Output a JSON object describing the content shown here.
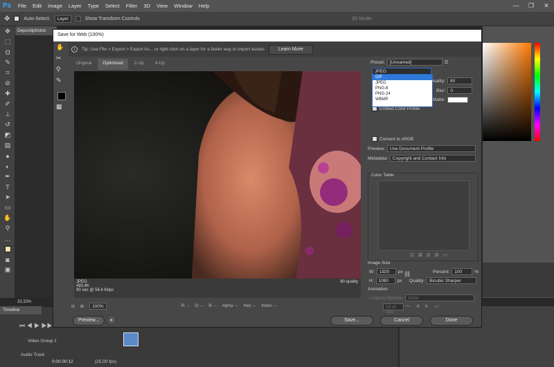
{
  "menubar": {
    "logo": "Ps",
    "items": [
      "File",
      "Edit",
      "Image",
      "Layer",
      "Type",
      "Select",
      "Filter",
      "3D",
      "View",
      "Window",
      "Help"
    ]
  },
  "window_controls": [
    "—",
    "❐",
    "✕"
  ],
  "options_bar": {
    "auto_select_label": "Auto-Select:",
    "auto_select_value": "Layer",
    "transform_label": "Show Transform Controls",
    "mode_label": "3D Mode:"
  },
  "document": {
    "tab_title": "Depositphotos",
    "zoom": "33,33%"
  },
  "timeline": {
    "tab": "Timeline",
    "video_group": "Video Group 1",
    "audio_track": "Audio Track",
    "timecode": "0:00:00:12",
    "fps": "(25,00 fps)"
  },
  "dialog": {
    "title": "Save for Web (100%)",
    "tip": "Tip: Use File > Export > Export As... or right click on a layer for a faster way to export assets",
    "learn_more": "Learn More",
    "tabs": [
      "Original",
      "Optimized",
      "2-Up",
      "4-Up"
    ],
    "active_tab": "Optimized",
    "preview_info": {
      "format": "JPEG",
      "size": "493,4K",
      "time": "90 sec @ 56.6 Kbps",
      "quality": "80 quality"
    },
    "zoom_value": "100%",
    "readouts": [
      "R: --",
      "G: --",
      "B: --",
      "Alpha: --",
      "Hex: --",
      "Index: --"
    ],
    "settings": {
      "preset_label": "Preset:",
      "preset_value": "[Unnamed]",
      "format_value": "JPEG",
      "format_options": [
        "GIF",
        "JPEG",
        "PNG-8",
        "PNG-24",
        "WBMP"
      ],
      "highlighted_option": "GIF",
      "quality_label": "Quality:",
      "quality_value": "80",
      "blur_label": "Blur:",
      "blur_value": "0",
      "matte_label": "Matte:",
      "embed_label": "Embed Color Profile",
      "convert_label": "Convert to sRGB",
      "preview_label": "Preview:",
      "preview_value": "Use Document Profile",
      "metadata_label": "Metadata:",
      "metadata_value": "Copyright and Contact Info",
      "color_table_label": "Color Table",
      "image_size_label": "Image Size",
      "w_label": "W:",
      "w_value": "1920",
      "h_label": "H:",
      "h_value": "1080",
      "unit": "px",
      "percent_label": "Percent:",
      "percent_value": "100",
      "percent_unit": "%",
      "iq_label": "Quality:",
      "iq_value": "Bicubic Sharper",
      "animation_label": "Animation",
      "looping_label": "Looping Options:",
      "looping_value": "Once",
      "frame_counter": "13 of 151"
    },
    "buttons": {
      "preview": "Preview...",
      "save": "Save...",
      "cancel": "Cancel",
      "done": "Done"
    }
  }
}
